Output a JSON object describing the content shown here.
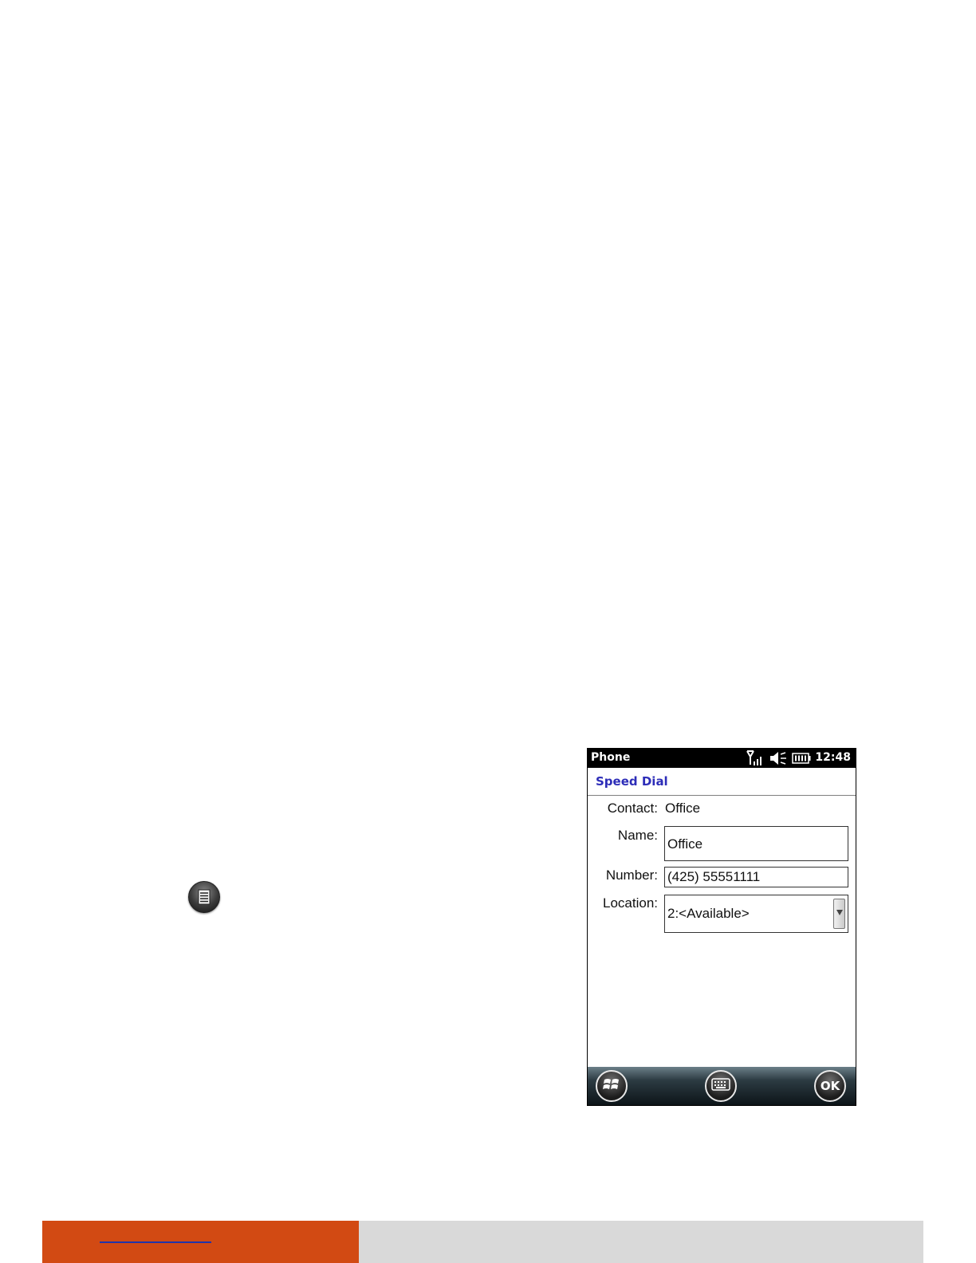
{
  "phone": {
    "status_bar": {
      "app_name": "Phone",
      "time": "12:48",
      "icons": [
        "signal-icon",
        "volume-muted-icon",
        "battery-icon"
      ]
    },
    "title": "Speed Dial",
    "form": {
      "contact_label": "Contact:",
      "contact_value": "Office",
      "name_label": "Name:",
      "name_value": "Office",
      "number_label": "Number:",
      "number_value": "(425) 55551111",
      "location_label": "Location:",
      "location_value": "2:<Available>"
    },
    "bottom_bar": {
      "start_icon": "windows-start-icon",
      "keyboard_icon": "keyboard-icon",
      "ok_label": "OK"
    }
  },
  "document": {
    "inline_icon": "menu-icon"
  },
  "colors": {
    "title_blue": "#2d2db8",
    "footer_orange": "#d24a13",
    "footer_gray": "#d9d9d9"
  }
}
